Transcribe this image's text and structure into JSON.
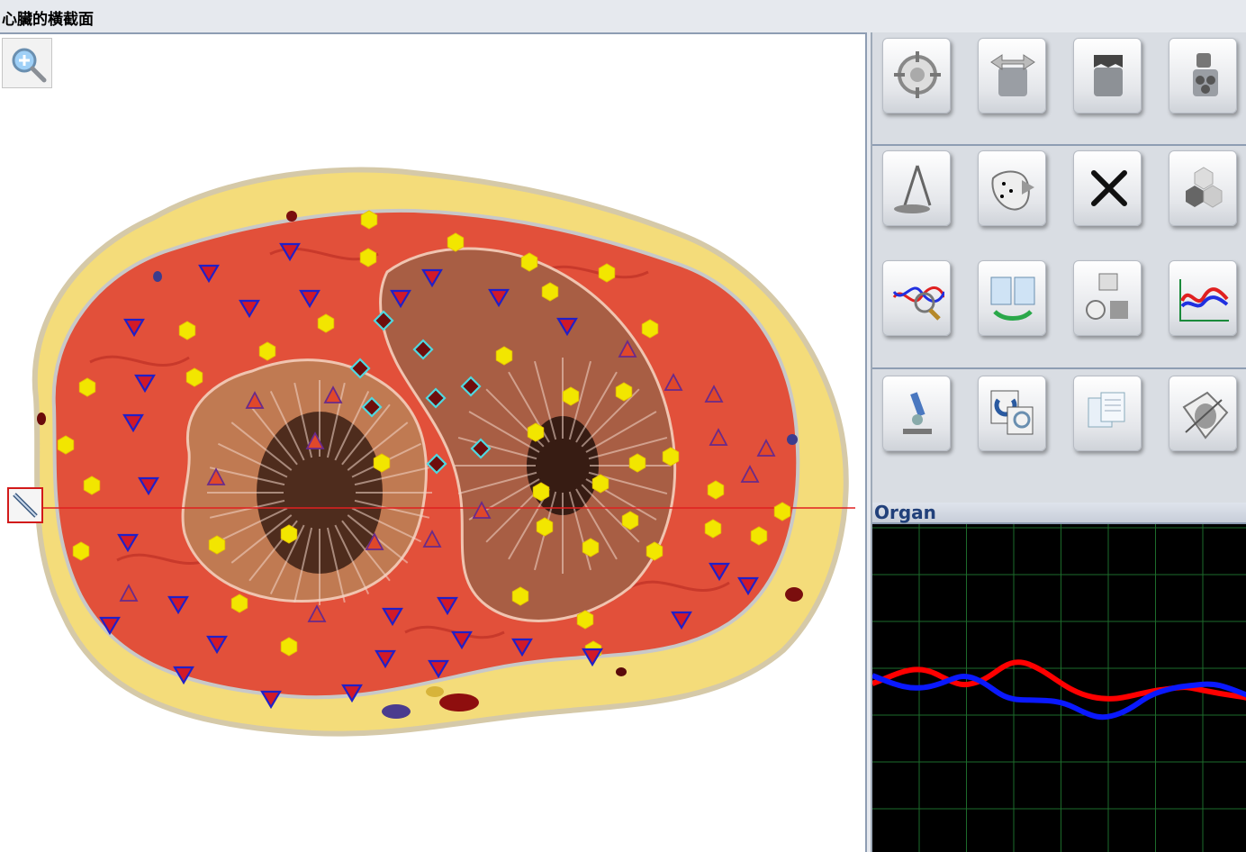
{
  "window": {
    "title": "心臟的橫截面"
  },
  "organ_panel": {
    "title": "Organ"
  },
  "icons": {
    "zoom": "zoom-in-icon",
    "scan": "scan-line-icon",
    "tools": [
      [
        "target-icon",
        "organ-expand-icon",
        "organ-collapse-icon",
        "organ-parts-icon"
      ],
      [
        "compass-tool-icon",
        "point-map-icon",
        "close-icon",
        "hexagon-cluster-icon"
      ],
      [
        "wave-analyze-icon",
        "report-exchange-icon",
        "data-export-icon",
        "multi-wave-chart-icon"
      ],
      [
        "microscope-icon",
        "image-compare-icon",
        "documents-icon",
        "organ-scan-icon"
      ]
    ]
  },
  "colors": {
    "marker_hexagon": "#f2e600",
    "marker_triangle_down": "#d21a28",
    "marker_triangle_up": "#e0482a",
    "marker_diamond": "#6e0d0d",
    "scan_line": "#e02020",
    "chart_series_red": "#ff0000",
    "chart_series_blue": "#0a19ff",
    "chart_grid": "#1d6b2b",
    "chart_background": "#000000"
  }
}
